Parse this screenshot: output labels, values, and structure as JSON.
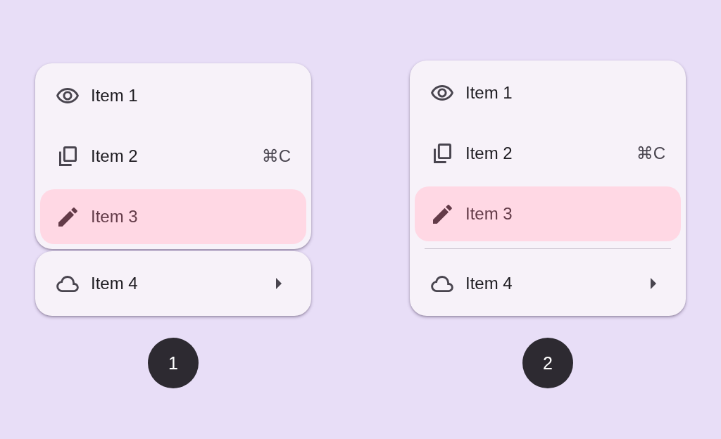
{
  "menus": [
    {
      "kind": "segmented",
      "sections": [
        {
          "items": [
            {
              "label": "Item 1",
              "selected": false,
              "submenu": false
            },
            {
              "label": "Item 2",
              "shortcut": "⌘C",
              "selected": false,
              "submenu": false
            },
            {
              "label": "Item 3",
              "selected": true,
              "submenu": false
            }
          ]
        },
        {
          "items": [
            {
              "label": "Item 4",
              "selected": false,
              "submenu": true
            }
          ]
        }
      ],
      "number": "1"
    },
    {
      "kind": "divided",
      "sections": [
        {
          "items": [
            {
              "label": "Item 1",
              "selected": false,
              "submenu": false
            },
            {
              "label": "Item 2",
              "shortcut": "⌘C",
              "selected": false,
              "submenu": false
            },
            {
              "label": "Item 3",
              "selected": true,
              "submenu": false
            }
          ]
        },
        {
          "items": [
            {
              "label": "Item 4",
              "selected": false,
              "submenu": true
            }
          ]
        }
      ],
      "number": "2"
    }
  ]
}
